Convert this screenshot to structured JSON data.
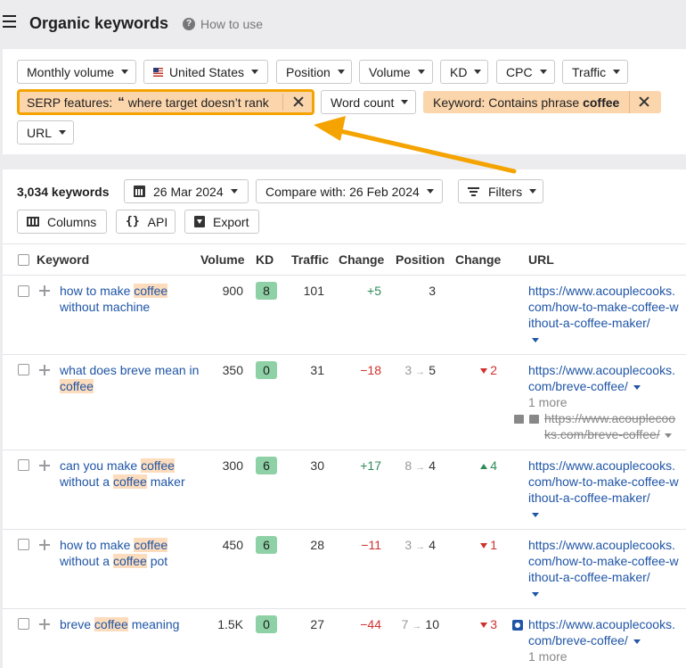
{
  "header": {
    "title": "Organic keywords",
    "how_to_use": "How to use"
  },
  "filters": {
    "monthly_volume": "Monthly volume",
    "country": "United States",
    "position": "Position",
    "volume": "Volume",
    "kd": "KD",
    "cpc": "CPC",
    "traffic": "Traffic",
    "serp_prefix": "SERP features:",
    "serp_value": "where target doesn’t rank",
    "word_count": "Word count",
    "keyword_prefix": "Keyword: Contains phrase ",
    "keyword_value": "coffee",
    "url": "URL"
  },
  "toolbar": {
    "count": "3,034 keywords",
    "date": "26 Mar 2024",
    "compare": "Compare with: 26 Feb 2024",
    "filters": "Filters",
    "columns": "Columns",
    "api": "API",
    "export": "Export"
  },
  "table": {
    "headers": {
      "keyword": "Keyword",
      "volume": "Volume",
      "kd": "KD",
      "traffic": "Traffic",
      "change": "Change",
      "position": "Position",
      "pos_change": "Change",
      "url": "URL"
    },
    "rows": [
      {
        "kw_parts": [
          "how to make ",
          "coffee",
          " without machine"
        ],
        "volume": "900",
        "kd": "8",
        "traffic": "101",
        "change": "+5",
        "position_old": "",
        "position": "3",
        "pos_change": "",
        "url": "https://www.acouplecooks.com/how-to-make-coffee-without-a-coffee-maker/"
      },
      {
        "kw_parts": [
          "what does breve mean in ",
          "coffee",
          ""
        ],
        "volume": "350",
        "kd": "0",
        "traffic": "31",
        "change": "−18",
        "position_old": "3",
        "position": "5",
        "pos_change": "2",
        "url": "https://www.acouplecooks.com/breve-coffee/",
        "more": "1 more",
        "old_url": "https://www.acouplecooks.com/breve-coffee/"
      },
      {
        "kw_parts": [
          "can you make ",
          "coffee",
          " without a ",
          "coffee",
          " maker"
        ],
        "volume": "300",
        "kd": "6",
        "traffic": "30",
        "change": "+17",
        "position_old": "8",
        "position": "4",
        "pos_change": "4",
        "url": "https://www.acouplecooks.com/how-to-make-coffee-without-a-coffee-maker/"
      },
      {
        "kw_parts": [
          "how to make ",
          "coffee",
          " without a ",
          "coffee",
          " pot"
        ],
        "volume": "450",
        "kd": "6",
        "traffic": "28",
        "change": "−11",
        "position_old": "3",
        "position": "4",
        "pos_change": "1",
        "url": "https://www.acouplecooks.com/how-to-make-coffee-without-a-coffee-maker/"
      },
      {
        "kw_parts": [
          "breve ",
          "coffee",
          " meaning"
        ],
        "volume": "1.5K",
        "kd": "0",
        "traffic": "27",
        "change": "−44",
        "position_old": "7",
        "position": "10",
        "pos_change": "3",
        "url": "https://www.acouplecooks.com/breve-coffee/",
        "more": "1 more"
      }
    ]
  },
  "colors": {
    "accent_orange": "#f4a300",
    "highlight": "#fcdcbc",
    "link_blue": "#1f55a6",
    "kd_green": "#8ed1a6",
    "up_green": "#2e8b57",
    "down_red": "#d0312d"
  },
  "icons": [
    "hamburger-icon",
    "help-icon",
    "us-flag-icon",
    "quote-icon",
    "close-icon",
    "calendar-icon",
    "filter-icon",
    "columns-icon",
    "api-icon",
    "export-icon",
    "checkbox-icon",
    "plus-icon",
    "caret-down-icon",
    "serp-feature-icon",
    "image-icon"
  ]
}
